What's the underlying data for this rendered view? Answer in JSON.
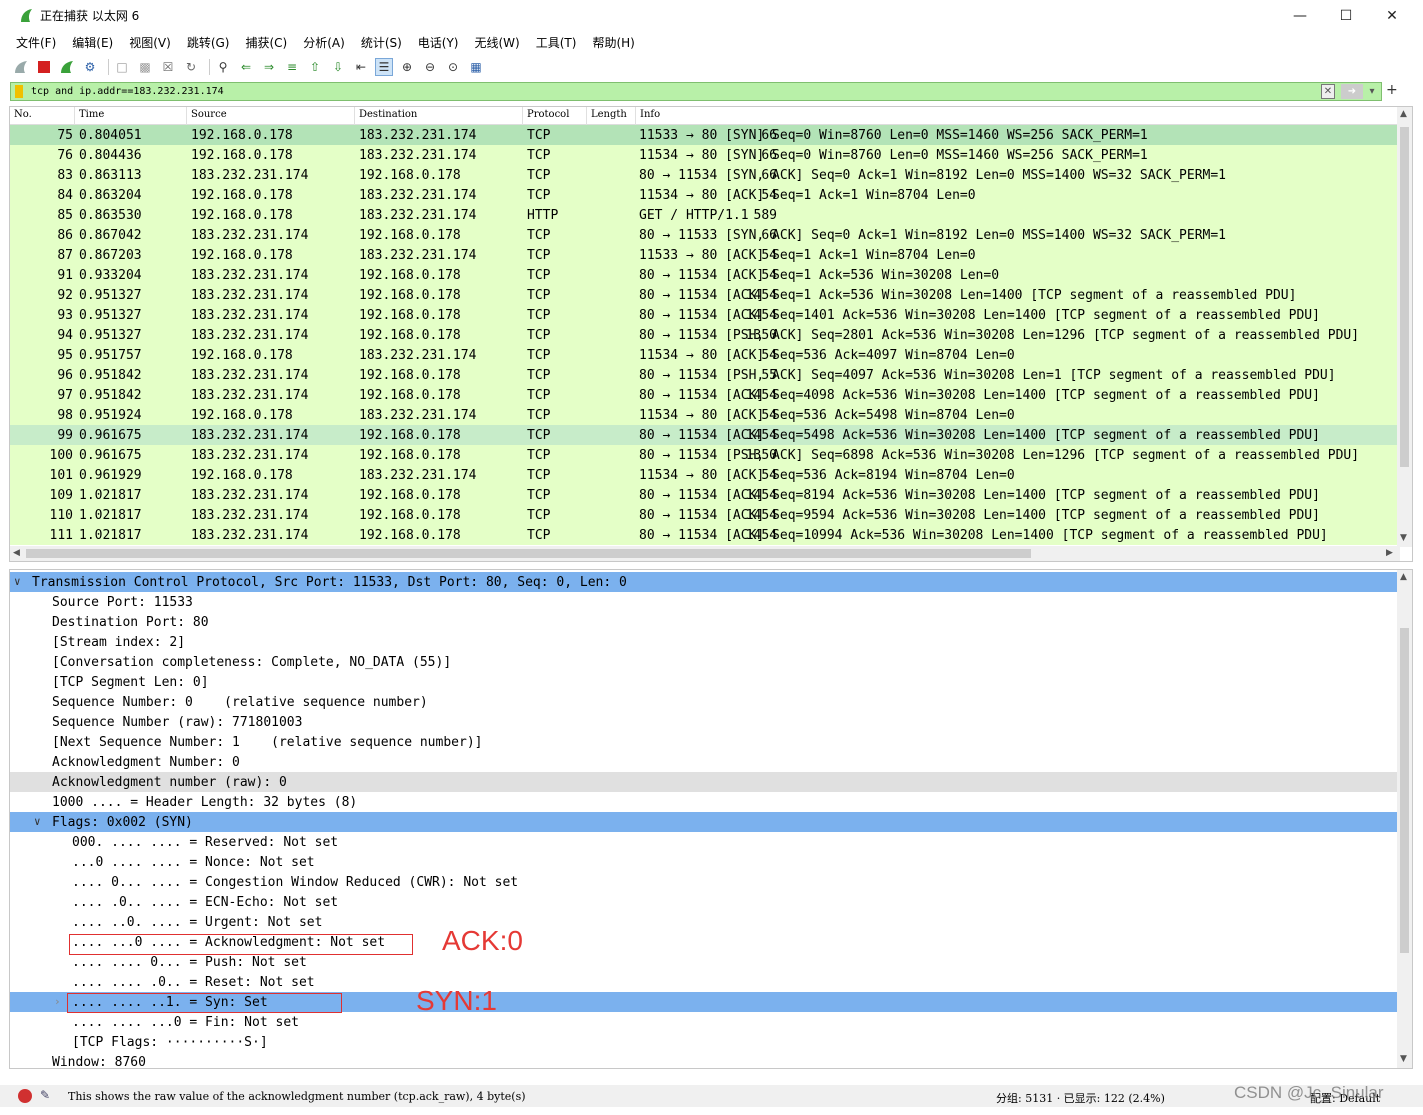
{
  "window": {
    "title": "正在捕获 以太网 6"
  },
  "menu": [
    "文件(F)",
    "编辑(E)",
    "视图(V)",
    "跳转(G)",
    "捕获(C)",
    "分析(A)",
    "统计(S)",
    "电话(Y)",
    "无线(W)",
    "工具(T)",
    "帮助(H)"
  ],
  "filter": {
    "value": "tcp and ip.addr==183.232.231.174"
  },
  "packet_columns": [
    "No.",
    "Time",
    "Source",
    "Destination",
    "Protocol",
    "Length",
    "Info"
  ],
  "packets": [
    {
      "no": "75",
      "time": "0.804051",
      "src": "192.168.0.178",
      "dst": "183.232.231.174",
      "proto": "TCP",
      "len": "66",
      "info": "11533 → 80 [SYN] Seq=0 Win=8760 Len=0 MSS=1460 WS=256 SACK_PERM=1"
    },
    {
      "no": "76",
      "time": "0.804436",
      "src": "192.168.0.178",
      "dst": "183.232.231.174",
      "proto": "TCP",
      "len": "66",
      "info": "11534 → 80 [SYN] Seq=0 Win=8760 Len=0 MSS=1460 WS=256 SACK_PERM=1"
    },
    {
      "no": "83",
      "time": "0.863113",
      "src": "183.232.231.174",
      "dst": "192.168.0.178",
      "proto": "TCP",
      "len": "66",
      "info": "80 → 11534 [SYN, ACK] Seq=0 Ack=1 Win=8192 Len=0 MSS=1400 WS=32 SACK_PERM=1"
    },
    {
      "no": "84",
      "time": "0.863204",
      "src": "192.168.0.178",
      "dst": "183.232.231.174",
      "proto": "TCP",
      "len": "54",
      "info": "11534 → 80 [ACK] Seq=1 Ack=1 Win=8704 Len=0"
    },
    {
      "no": "85",
      "time": "0.863530",
      "src": "192.168.0.178",
      "dst": "183.232.231.174",
      "proto": "HTTP",
      "len": "589",
      "info": "GET / HTTP/1.1"
    },
    {
      "no": "86",
      "time": "0.867042",
      "src": "183.232.231.174",
      "dst": "192.168.0.178",
      "proto": "TCP",
      "len": "66",
      "info": "80 → 11533 [SYN, ACK] Seq=0 Ack=1 Win=8192 Len=0 MSS=1400 WS=32 SACK_PERM=1"
    },
    {
      "no": "87",
      "time": "0.867203",
      "src": "192.168.0.178",
      "dst": "183.232.231.174",
      "proto": "TCP",
      "len": "54",
      "info": "11533 → 80 [ACK] Seq=1 Ack=1 Win=8704 Len=0"
    },
    {
      "no": "91",
      "time": "0.933204",
      "src": "183.232.231.174",
      "dst": "192.168.0.178",
      "proto": "TCP",
      "len": "54",
      "info": "80 → 11534 [ACK] Seq=1 Ack=536 Win=30208 Len=0"
    },
    {
      "no": "92",
      "time": "0.951327",
      "src": "183.232.231.174",
      "dst": "192.168.0.178",
      "proto": "TCP",
      "len": "1454",
      "info": "80 → 11534 [ACK] Seq=1 Ack=536 Win=30208 Len=1400 [TCP segment of a reassembled PDU]"
    },
    {
      "no": "93",
      "time": "0.951327",
      "src": "183.232.231.174",
      "dst": "192.168.0.178",
      "proto": "TCP",
      "len": "1454",
      "info": "80 → 11534 [ACK] Seq=1401 Ack=536 Win=30208 Len=1400 [TCP segment of a reassembled PDU]"
    },
    {
      "no": "94",
      "time": "0.951327",
      "src": "183.232.231.174",
      "dst": "192.168.0.178",
      "proto": "TCP",
      "len": "1350",
      "info": "80 → 11534 [PSH, ACK] Seq=2801 Ack=536 Win=30208 Len=1296 [TCP segment of a reassembled PDU]"
    },
    {
      "no": "95",
      "time": "0.951757",
      "src": "192.168.0.178",
      "dst": "183.232.231.174",
      "proto": "TCP",
      "len": "54",
      "info": "11534 → 80 [ACK] Seq=536 Ack=4097 Win=8704 Len=0"
    },
    {
      "no": "96",
      "time": "0.951842",
      "src": "183.232.231.174",
      "dst": "192.168.0.178",
      "proto": "TCP",
      "len": "55",
      "info": "80 → 11534 [PSH, ACK] Seq=4097 Ack=536 Win=30208 Len=1 [TCP segment of a reassembled PDU]"
    },
    {
      "no": "97",
      "time": "0.951842",
      "src": "183.232.231.174",
      "dst": "192.168.0.178",
      "proto": "TCP",
      "len": "1454",
      "info": "80 → 11534 [ACK] Seq=4098 Ack=536 Win=30208 Len=1400 [TCP segment of a reassembled PDU]"
    },
    {
      "no": "98",
      "time": "0.951924",
      "src": "192.168.0.178",
      "dst": "183.232.231.174",
      "proto": "TCP",
      "len": "54",
      "info": "11534 → 80 [ACK] Seq=536 Ack=5498 Win=8704 Len=0"
    },
    {
      "no": "99",
      "time": "0.961675",
      "src": "183.232.231.174",
      "dst": "192.168.0.178",
      "proto": "TCP",
      "len": "1454",
      "info": "80 → 11534 [ACK] Seq=5498 Ack=536 Win=30208 Len=1400 [TCP segment of a reassembled PDU]"
    },
    {
      "no": "100",
      "time": "0.961675",
      "src": "183.232.231.174",
      "dst": "192.168.0.178",
      "proto": "TCP",
      "len": "1350",
      "info": "80 → 11534 [PSH, ACK] Seq=6898 Ack=536 Win=30208 Len=1296 [TCP segment of a reassembled PDU]"
    },
    {
      "no": "101",
      "time": "0.961929",
      "src": "192.168.0.178",
      "dst": "183.232.231.174",
      "proto": "TCP",
      "len": "54",
      "info": "11534 → 80 [ACK] Seq=536 Ack=8194 Win=8704 Len=0"
    },
    {
      "no": "109",
      "time": "1.021817",
      "src": "183.232.231.174",
      "dst": "192.168.0.178",
      "proto": "TCP",
      "len": "1454",
      "info": "80 → 11534 [ACK] Seq=8194 Ack=536 Win=30208 Len=1400 [TCP segment of a reassembled PDU]"
    },
    {
      "no": "110",
      "time": "1.021817",
      "src": "183.232.231.174",
      "dst": "192.168.0.178",
      "proto": "TCP",
      "len": "1454",
      "info": "80 → 11534 [ACK] Seq=9594 Ack=536 Win=30208 Len=1400 [TCP segment of a reassembled PDU]"
    },
    {
      "no": "111",
      "time": "1.021817",
      "src": "183.232.231.174",
      "dst": "192.168.0.178",
      "proto": "TCP",
      "len": "1454",
      "info": "80 → 11534 [ACK] Seq=10994 Ack=536 Win=30208 Len=1400 [TCP segment of a reassembled PDU]"
    }
  ],
  "details": [
    {
      "text": "Transmission Control Protocol, Src Port: 11533, Dst Port: 80, Seq: 0, Len: 0"
    },
    {
      "text": "Source Port: 11533"
    },
    {
      "text": "Destination Port: 80"
    },
    {
      "text": "[Stream index: 2]"
    },
    {
      "text": "[Conversation completeness: Complete, NO_DATA (55)]"
    },
    {
      "text": "[TCP Segment Len: 0]"
    },
    {
      "text": "Sequence Number: 0    (relative sequence number)"
    },
    {
      "text": "Sequence Number (raw): 771801003"
    },
    {
      "text": "[Next Sequence Number: 1    (relative sequence number)]"
    },
    {
      "text": "Acknowledgment Number: 0"
    },
    {
      "text": "Acknowledgment number (raw): 0"
    },
    {
      "text": "1000 .... = Header Length: 32 bytes (8)"
    },
    {
      "text": "Flags: 0x002 (SYN)"
    },
    {
      "text": "000. .... .... = Reserved: Not set"
    },
    {
      "text": "...0 .... .... = Nonce: Not set"
    },
    {
      "text": ".... 0... .... = Congestion Window Reduced (CWR): Not set"
    },
    {
      "text": ".... .0.. .... = ECN-Echo: Not set"
    },
    {
      "text": ".... ..0. .... = Urgent: Not set"
    },
    {
      "text": ".... ...0 .... = Acknowledgment: Not set"
    },
    {
      "text": ".... .... 0... = Push: Not set"
    },
    {
      "text": ".... .... .0.. = Reset: Not set"
    },
    {
      "text": ".... .... ..1. = Syn: Set"
    },
    {
      "text": ".... .... ...0 = Fin: Not set"
    },
    {
      "text": "[TCP Flags: ··········S·]"
    },
    {
      "text": "Window: 8760"
    }
  ],
  "annotations": {
    "ack": "ACK:0",
    "syn": "SYN:1"
  },
  "status": {
    "message": "This shows the raw value of the acknowledgment number (tcp.ack_raw), 4 byte(s)",
    "stats": "分组: 5131 · 已显示: 122 (2.4%)",
    "profile": "配置: Default"
  },
  "watermark": "CSDN @Jc_Sinular",
  "colors": {
    "row_bg": "#e4ffc7",
    "row_highlight": "#c7ecc9",
    "detail_selected": "#7bb1ee",
    "filter_bg": "#b8f0a8",
    "annotation": "#e53935"
  }
}
